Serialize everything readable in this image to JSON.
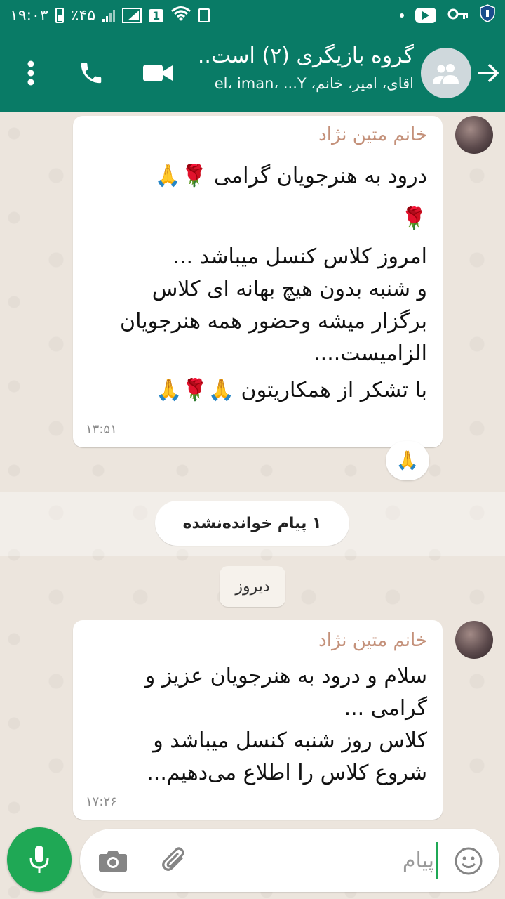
{
  "status_bar": {
    "time": "۱۹:۰۳",
    "battery": "٪۴۵",
    "sim_badge": "1"
  },
  "header": {
    "group_name": "گروه بازیگری (۲) است..",
    "members": "اقای، امیر، خانم، el، iman، ...Y"
  },
  "messages": [
    {
      "sender": "خانم متین نژاد",
      "lines": [
        "درود به هنرجویان گرامی 🌹🙏",
        "🌹",
        "امروز کلاس کنسل میباشد ...",
        "و شنبه بدون هیچ بهانه ای  کلاس",
        "برگزار میشه وحضور همه هنرجویان",
        "الزامیست....",
        "با تشکر از همکاریتون 🙏🌹🙏"
      ],
      "time": "۱۳:۵۱",
      "reaction": "🙏"
    },
    {
      "sender": "خانم متین نژاد",
      "lines": [
        "سلام و درود به هنرجویان عزیز و",
        "گرامی ...",
        "کلاس روز شنبه کنسل میباشد و",
        "شروع کلاس را اطلاع  می‌دهیم..."
      ],
      "time": "۱۷:۲۶"
    }
  ],
  "unread_banner": "۱ پیام خوانده‌نشده",
  "date_chip": "دیروز",
  "composer": {
    "placeholder": "پیام"
  },
  "colors": {
    "header": "#097b66",
    "accent": "#1fa855",
    "sender": "#c4917a",
    "chat_bg": "#ece5dd"
  },
  "icons": [
    "back-arrow-icon",
    "group-avatar-icon",
    "video-call-icon",
    "phone-call-icon",
    "more-vert-icon",
    "emoji-icon",
    "attach-icon",
    "camera-icon",
    "mic-icon"
  ]
}
